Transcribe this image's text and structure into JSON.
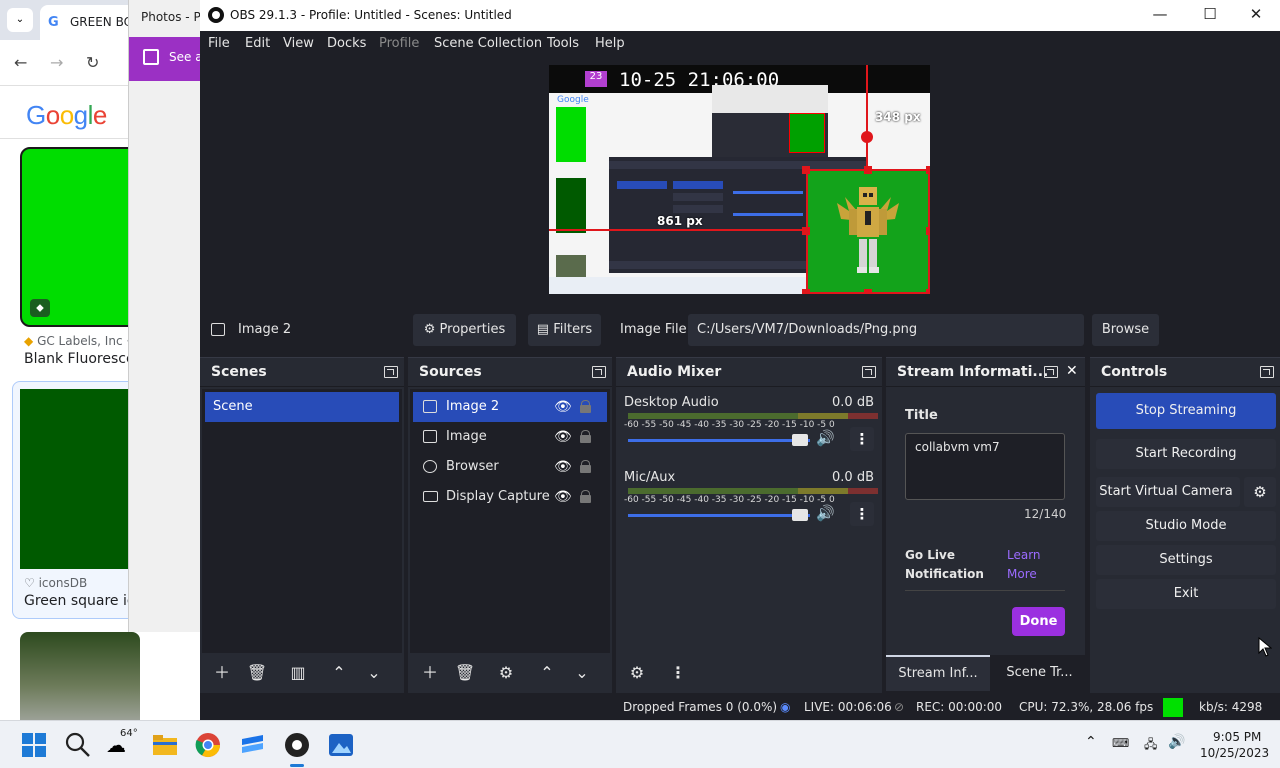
{
  "chrome": {
    "tab_title": "GREEN BO",
    "tab_dropdown": "⌄",
    "logo_text": "Google",
    "result1_source": "GC Labels, Inc ·",
    "result1_title": "Blank Fluorescen",
    "result2_source": "iconsDB",
    "result2_title": "Green square ico"
  },
  "photos": {
    "title": "Photos - Pr",
    "banner_text": "See al"
  },
  "obs": {
    "window_title": "OBS 29.1.3 - Profile: Untitled - Scenes: Untitled",
    "menu": [
      "File",
      "Edit",
      "View",
      "Docks",
      "Profile",
      "Scene Collection",
      "Tools",
      "Help"
    ],
    "preview": {
      "clock_text": "10-25 21:06:00",
      "clock_badge": "23",
      "mini_google": "Google",
      "height_label": "348 px",
      "width_label": "861 px"
    },
    "source_toolbar": {
      "selected_source": "Image 2",
      "properties_label": "Properties",
      "filters_label": "Filters",
      "image_file_label": "Image File",
      "image_path": "C:/Users/VM7/Downloads/Png.png",
      "browse_label": "Browse"
    },
    "scenes": {
      "title": "Scenes",
      "items": [
        "Scene"
      ]
    },
    "sources": {
      "title": "Sources",
      "items": [
        {
          "name": "Image 2",
          "icon": "image-icon",
          "selected": true
        },
        {
          "name": "Image",
          "icon": "image-icon",
          "selected": false
        },
        {
          "name": "Browser",
          "icon": "globe-icon",
          "selected": false
        },
        {
          "name": "Display Capture",
          "icon": "monitor-icon",
          "selected": false
        }
      ]
    },
    "audio_mixer": {
      "title": "Audio Mixer",
      "ticks": "-60 -55 -50 -45 -40 -35 -30 -25 -20 -15 -10 -5 0",
      "channels": [
        {
          "name": "Desktop Audio",
          "level": "0.0 dB"
        },
        {
          "name": "Mic/Aux",
          "level": "0.0 dB"
        }
      ]
    },
    "stream_info": {
      "title": "Stream Informati...",
      "field_title_label": "Title",
      "field_title_value": "collabvm vm7",
      "char_count": "12/140",
      "go_live_label": "Go Live Notification",
      "learn_more": "Learn More",
      "done_label": "Done",
      "tab1": "Stream Inf...",
      "tab2": "Scene Tr..."
    },
    "controls": {
      "title": "Controls",
      "stop_streaming": "Stop Streaming",
      "start_recording": "Start Recording",
      "start_virtual_camera": "Start Virtual Camera",
      "studio_mode": "Studio Mode",
      "settings": "Settings",
      "exit": "Exit"
    },
    "status": {
      "dropped_frames": "Dropped Frames 0 (0.0%)",
      "live": "LIVE: 00:06:06",
      "rec": "REC: 00:00:00",
      "cpu": "CPU: 72.3%, 28.06 fps",
      "kbs": "kb/s: 4298"
    }
  },
  "taskbar": {
    "weather_temp": "64°",
    "time": "9:05 PM",
    "date": "10/25/2023"
  },
  "colors": {
    "obs_bg": "#1e1f26",
    "obs_panel": "#272a33",
    "obs_accent": "#284cb8",
    "done_purple": "#9b30e0",
    "green_screen": "#13a31b"
  }
}
